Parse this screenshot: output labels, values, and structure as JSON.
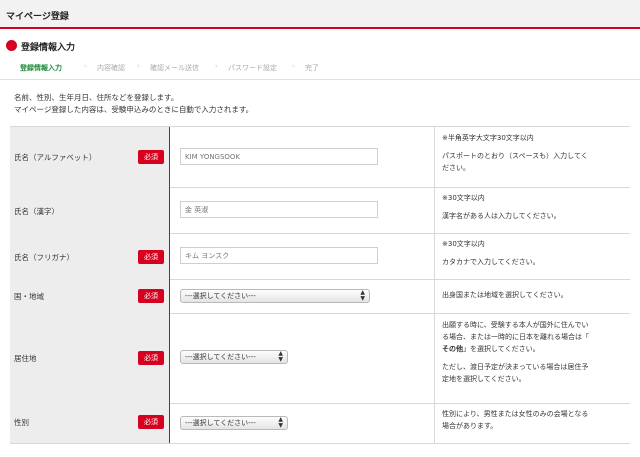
{
  "header": {
    "title": "マイページ登録"
  },
  "section": {
    "title": "登録情報入力"
  },
  "steps": [
    {
      "label": "登録情報入力",
      "active": true
    },
    {
      "label": "内容確認",
      "active": false
    },
    {
      "label": "確認メール送信",
      "active": false
    },
    {
      "label": "パスワード設定",
      "active": false
    },
    {
      "label": "完了",
      "active": false
    }
  ],
  "intro": {
    "line1": "名前、性別、生年月日、住所などを登録します。",
    "line2": "マイページ登録した内容は、受験申込みのときに自動で入力されます。"
  },
  "required_label": "必須",
  "fields": {
    "name_alpha": {
      "label": "氏名（アルファベット）",
      "required": true,
      "placeholder": "KIM YONGSOOK",
      "note1": "※半角英字大文字30文字以内",
      "note2": "パスポートのとおり（スペースも）入力してく",
      "note3": "ださい。"
    },
    "name_kanji": {
      "label": "氏名（漢字）",
      "required": false,
      "placeholder": "金 英淑",
      "note1": "※30文字以内",
      "note2": "漢字名がある人は入力してください。"
    },
    "name_kana": {
      "label": "氏名（フリガナ）",
      "required": true,
      "placeholder": "キム ヨンスク",
      "note1": "※30文字以内",
      "note2": "カタカナで入力してください。"
    },
    "country": {
      "label": "国・地域",
      "required": true,
      "select": "---選択してください---",
      "note1": "出身国または地域を選択してください。"
    },
    "residence": {
      "label": "居住地",
      "required": true,
      "select": "---選択してください---",
      "note1": "出願する時に、受験する本人が国外に住んでい",
      "note2": "る場合、または一時的に日本を離れる場合は「",
      "note3_bold": "その他",
      "note3_rest": "」を選択してください。",
      "note4": "ただし、渡日予定が決まっている場合は居住予",
      "note5": "定地を選択してください。"
    },
    "gender": {
      "label": "性別",
      "required": true,
      "select": "---選択してください---",
      "note1": "性別により、男性または女性のみの会場となる",
      "note2": "場合があります。"
    }
  },
  "colors": {
    "accent": "#d7001f",
    "active_step": "#1f8a3c"
  }
}
